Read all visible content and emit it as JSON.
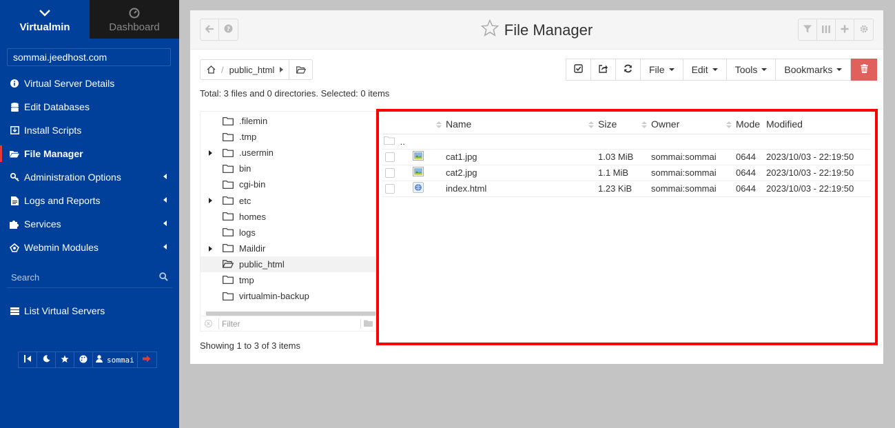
{
  "sidebar": {
    "tabs": [
      {
        "label": "Virtualmin",
        "icon": "chevron-down-icon",
        "active": true
      },
      {
        "label": "Dashboard",
        "icon": "gauge-icon",
        "active": false
      }
    ],
    "host": "sommai.jeedhost.com",
    "menu": [
      {
        "label": "Virtual Server Details",
        "icon": "info-icon"
      },
      {
        "label": "Edit Databases",
        "icon": "database-icon"
      },
      {
        "label": "Install Scripts",
        "icon": "download-box-icon"
      },
      {
        "label": "File Manager",
        "icon": "folder-open-icon",
        "active": true
      },
      {
        "label": "Administration Options",
        "icon": "key-icon",
        "submenu": true
      },
      {
        "label": "Logs and Reports",
        "icon": "file-text-icon",
        "submenu": true
      },
      {
        "label": "Services",
        "icon": "puzzle-icon",
        "submenu": true
      },
      {
        "label": "Webmin Modules",
        "icon": "modules-icon",
        "submenu": true
      }
    ],
    "search_placeholder": "Search",
    "list_servers": "List Virtual Servers",
    "bottom_user": "sommai"
  },
  "header": {
    "title": "File Manager"
  },
  "breadcrumb": {
    "folder": "public_html"
  },
  "toolbar": {
    "file": "File",
    "edit": "Edit",
    "tools": "Tools",
    "bookmarks": "Bookmarks"
  },
  "summary": "Total: 3 files and 0 directories. Selected: 0 items",
  "tree": {
    "items": [
      {
        "name": ".filemin",
        "expandable": false
      },
      {
        "name": ".tmp",
        "expandable": false
      },
      {
        "name": ".usermin",
        "expandable": true
      },
      {
        "name": "bin",
        "expandable": false
      },
      {
        "name": "cgi-bin",
        "expandable": false
      },
      {
        "name": "etc",
        "expandable": true
      },
      {
        "name": "homes",
        "expandable": false
      },
      {
        "name": "logs",
        "expandable": false
      },
      {
        "name": "Maildir",
        "expandable": true
      },
      {
        "name": "public_html",
        "expandable": false,
        "selected": true
      },
      {
        "name": "tmp",
        "expandable": false
      },
      {
        "name": "virtualmin-backup",
        "expandable": false
      }
    ],
    "filter_placeholder": "Filter"
  },
  "table": {
    "headers": {
      "name": "Name",
      "size": "Size",
      "owner": "Owner",
      "mode": "Mode",
      "modified": "Modified"
    },
    "parent": "..",
    "rows": [
      {
        "name": "cat1.jpg",
        "icon": "image-file-icon",
        "size": "1.03 MiB",
        "owner": "sommai:sommai",
        "mode": "0644",
        "modified": "2023/10/03 - 22:19:50"
      },
      {
        "name": "cat2.jpg",
        "icon": "image-file-icon",
        "size": "1.1 MiB",
        "owner": "sommai:sommai",
        "mode": "0644",
        "modified": "2023/10/03 - 22:19:50"
      },
      {
        "name": "index.html",
        "icon": "html-file-icon",
        "size": "1.23 KiB",
        "owner": "sommai:sommai",
        "mode": "0644",
        "modified": "2023/10/03 - 22:19:50"
      }
    ]
  },
  "showing": "Showing 1 to 3 of 3 items",
  "colors": {
    "sidebar_bg": "#01409a",
    "active_marker": "#e53935",
    "delete_button": "#e0605b",
    "highlight": "#ff0000"
  }
}
